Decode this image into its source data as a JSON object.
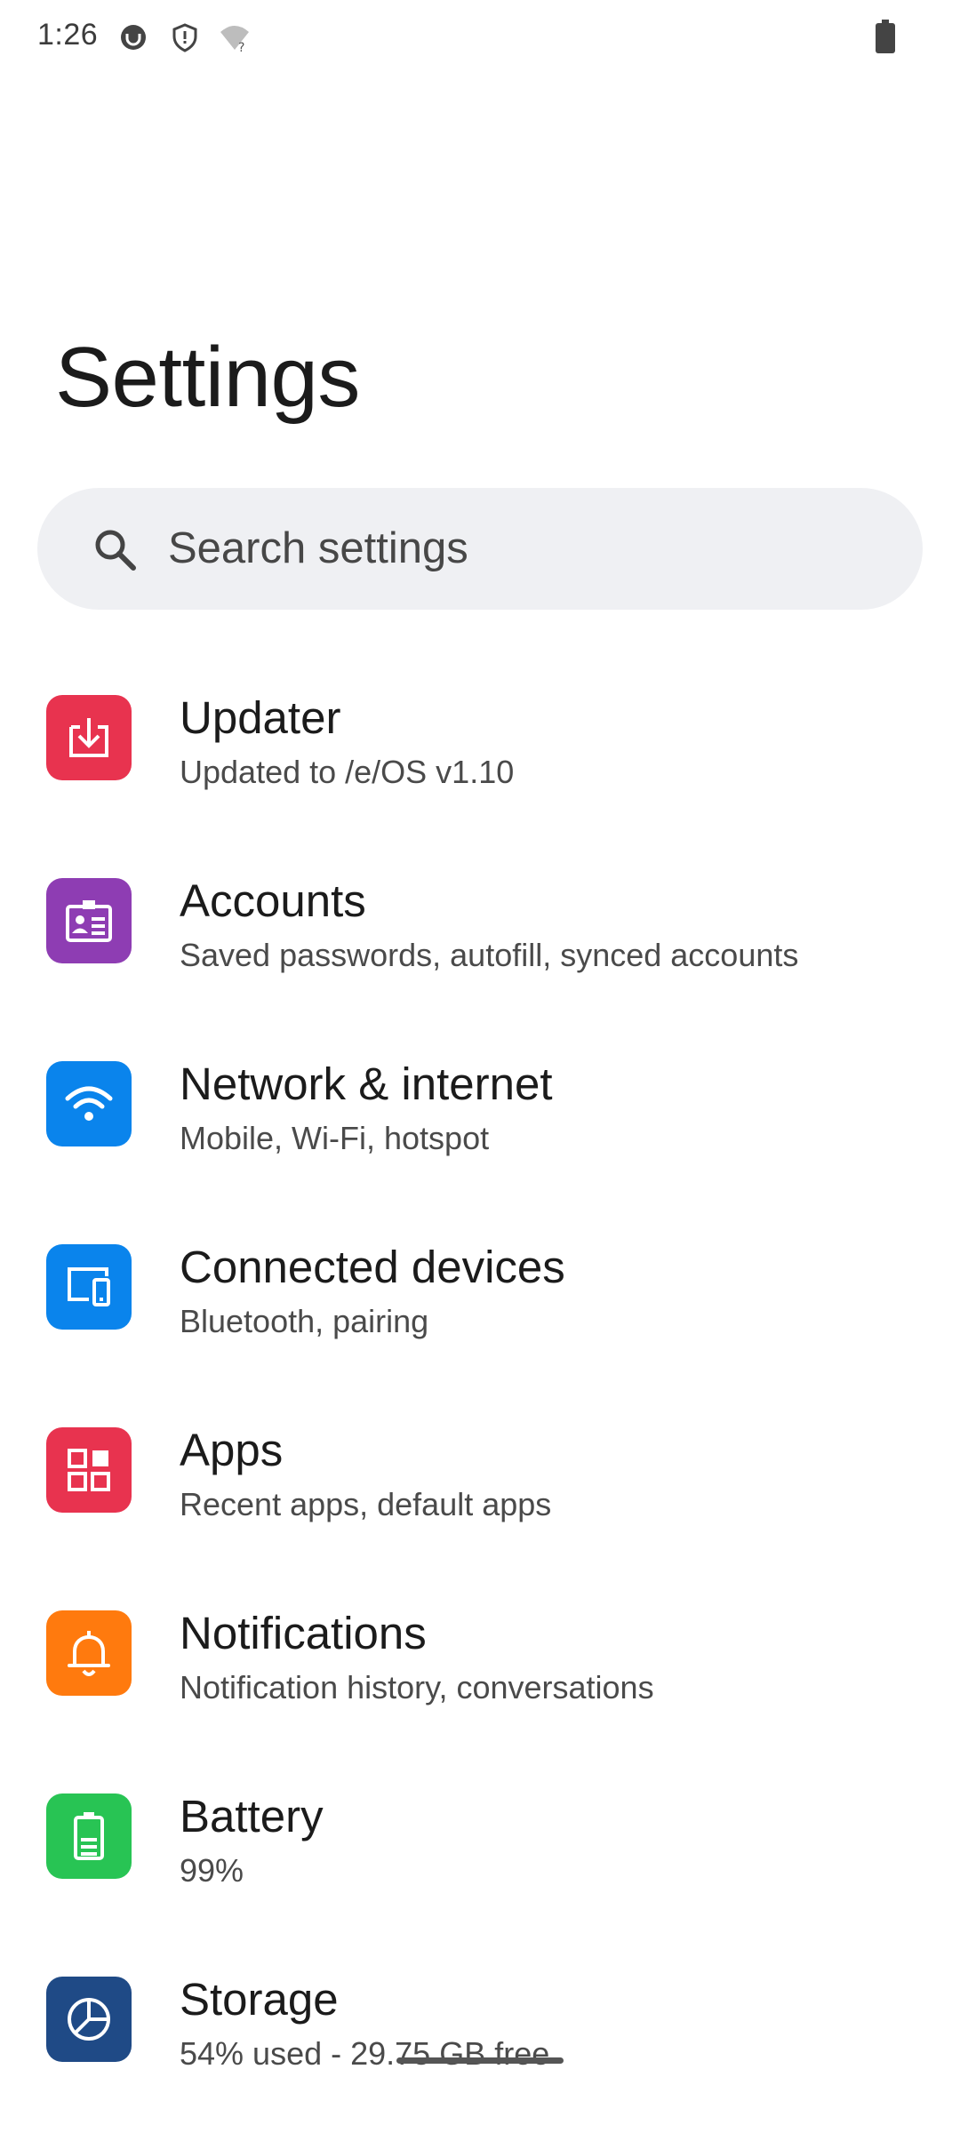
{
  "status_bar": {
    "time": "1:26",
    "icons": [
      "notification-app-icon",
      "vpn-shield-icon",
      "wifi-unknown-icon",
      "battery-icon"
    ]
  },
  "page": {
    "title": "Settings"
  },
  "search": {
    "placeholder": "Search settings"
  },
  "settings_items": [
    {
      "title": "Updater",
      "summary": "Updated to /e/OS v1.10",
      "icon": "updater-icon",
      "color": "#e8334f"
    },
    {
      "title": "Accounts",
      "summary": "Saved passwords, autofill, synced accounts",
      "icon": "accounts-icon",
      "color": "#8e3db3"
    },
    {
      "title": "Network & internet",
      "summary": "Mobile, Wi‑Fi, hotspot",
      "icon": "wifi-icon",
      "color": "#0a84ec"
    },
    {
      "title": "Connected devices",
      "summary": "Bluetooth, pairing",
      "icon": "devices-icon",
      "color": "#0a84ec"
    },
    {
      "title": "Apps",
      "summary": "Recent apps, default apps",
      "icon": "apps-grid-icon",
      "color": "#e8334f"
    },
    {
      "title": "Notifications",
      "summary": "Notification history, conversations",
      "icon": "bell-icon",
      "color": "#ff7a0e"
    },
    {
      "title": "Battery",
      "summary": "99%",
      "icon": "battery-icon",
      "color": "#28c454"
    },
    {
      "title": "Storage",
      "summary": "54% used - 29.75 GB free",
      "icon": "storage-pie-icon",
      "color": "#1f4a86"
    }
  ]
}
